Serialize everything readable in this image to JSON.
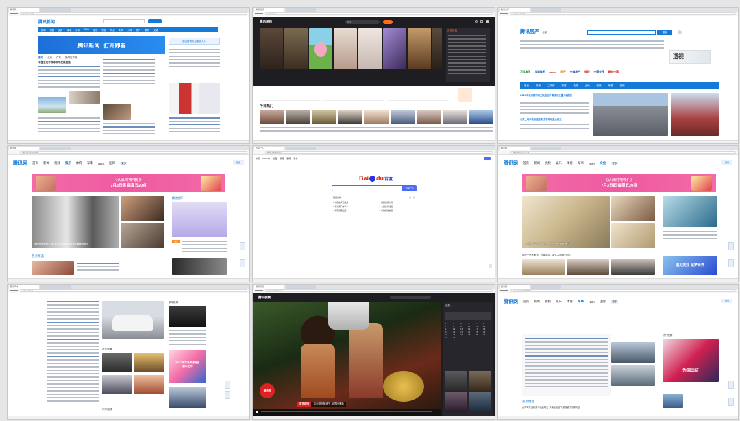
{
  "panes": {
    "qq_news": {
      "tab": "腾讯网",
      "url": "news.qq.com",
      "logo": "腾讯新闻",
      "banner_title": "腾讯新闻",
      "banner_sub": "打开即看",
      "right_banner": "全国疫情防控服务入口",
      "nav": [
        "新闻",
        "视频",
        "图片",
        "军事",
        "体育",
        "NBA",
        "娱乐",
        "财经",
        "科技",
        "时尚",
        "汽车",
        "房产",
        "教育",
        "文化"
      ],
      "subnav": [
        "要闻",
        "北京",
        "广东",
        "新闻客户端"
      ],
      "headline": "中国坚定不移走和平发展道路"
    },
    "qq_video": {
      "tab": "腾讯视频",
      "url": "v.qq.com",
      "logo": "腾讯视频",
      "search": "搜索",
      "section_title": "今日热门",
      "sidebar_title": "正在热播"
    },
    "qq_house": {
      "tab": "腾讯房产",
      "url": "house.qq.com",
      "logo": "腾讯房产",
      "city": "北京",
      "search_button": "搜索",
      "ad_text": "透视",
      "brands": [
        "万科集团",
        "龙湖集团",
        "vanke",
        "首开",
        "中海地产",
        "保利",
        "中国金茂",
        "融创中国"
      ],
      "nav": [
        "首页",
        "新房",
        "二手房",
        "家居",
        "装修",
        "土地",
        "政策",
        "专题",
        "视频"
      ],
      "headline": "2020年北京楼市成交数据出炉 新房成交量大幅回升",
      "subhead": "北京土地市场热度延续 多宗地块溢价成交"
    },
    "qq_ent": {
      "tab": "腾讯网",
      "url": "new.qq.com/ch/ent",
      "logo": "腾讯网",
      "nav": [
        "首页",
        "新闻",
        "视频",
        "娱乐",
        "体育",
        "军事",
        "NBA",
        "国际",
        "更多"
      ],
      "active_nav": "娱乐",
      "login": "登录",
      "banner": "《认真的嘎嘎们》",
      "banner_sub": "7月3日起 每周五20点",
      "section": "热点精选",
      "caption": "她的美貌惊艳了整个时代 曾被称为世界上最美的女人",
      "side_title": "精选推荐",
      "side_badge": "独家"
    },
    "baidu": {
      "tab": "百度一下",
      "url": "www.baidu.com",
      "top_links": [
        "新闻",
        "hao123",
        "地图",
        "视频",
        "贴吧",
        "学术"
      ],
      "logo_left": "Bai",
      "logo_mark": "du",
      "logo_right": "百度",
      "search_button": "百度一下",
      "hot_title": "百度热榜",
      "hot_refresh": "换一换",
      "hot_items": [
        "1 中国航天员乘组",
        "2 暑期旅游市场",
        "3 新能源汽车下乡",
        "4 全国高考成绩",
        "5 端午假期出游",
        "6 夏粮收购进展"
      ]
    },
    "qq_culture": {
      "tab": "腾讯网",
      "url": "new.qq.com/ch/cul",
      "logo": "腾讯网",
      "nav": [
        "首页",
        "新闻",
        "视频",
        "娱乐",
        "体育",
        "军事",
        "NBA",
        "文化",
        "更多"
      ],
      "active_nav": "文化",
      "login": "登录",
      "banner": "《认真的嘎嘎们》",
      "banner_sub": "7月3日起 每周五20点",
      "caption": "水墨丹青中的文化传承 感受千年书画艺术之美",
      "sub_caption": "传统文化大家谈：守望非遗，留住人间烟火回忆",
      "card_text": "遇见美好 追梦世界"
    },
    "qq_auto": {
      "tab": "腾讯汽车",
      "url": "auto.qq.com",
      "sections": [
        "汽车频道",
        "汽车视频"
      ],
      "side_title": "新车推荐",
      "poster": "2022汽车世界博览会",
      "poster_sub": "新车上市"
    },
    "qq_video_play": {
      "tab": "腾讯视频",
      "url": "v.qq.com/x/cover",
      "logo": "腾讯视频",
      "subtitle_brand": "京东超市",
      "subtitle_text": "京东超市啤酒节 品质好啤酒",
      "badge": "啤酒节",
      "episodes_title": "选集",
      "episodes": [
        "1",
        "2",
        "3",
        "4",
        "5",
        "6",
        "7",
        "8",
        "9",
        "10",
        "11",
        "12",
        "13",
        "14",
        "15",
        "16",
        "17",
        "18",
        "19",
        "20",
        "21",
        "22",
        "23",
        "24",
        "25",
        "26",
        "27",
        "28",
        "29",
        "30",
        "31",
        "32"
      ]
    },
    "qq_mil": {
      "tab": "腾讯网",
      "url": "new.qq.com/ch/milite",
      "logo": "腾讯网",
      "nav": [
        "首页",
        "新闻",
        "视频",
        "娱乐",
        "体育",
        "军事",
        "NBA",
        "国际",
        "更多"
      ],
      "active_nav": "军事",
      "login": "登录",
      "section": "热点精选",
      "side_title": "热门视频",
      "poster": "为国出征",
      "headline": "台湾军方战机演习画面曝光 多架战机起飞 机身细节清晰可见"
    }
  },
  "colors": {
    "qq_blue": "#1479d7",
    "pink": "#f36ba7",
    "video_dark": "#1e1e22",
    "baidu_red": "#de2910",
    "baidu_blue": "#2932e1"
  }
}
